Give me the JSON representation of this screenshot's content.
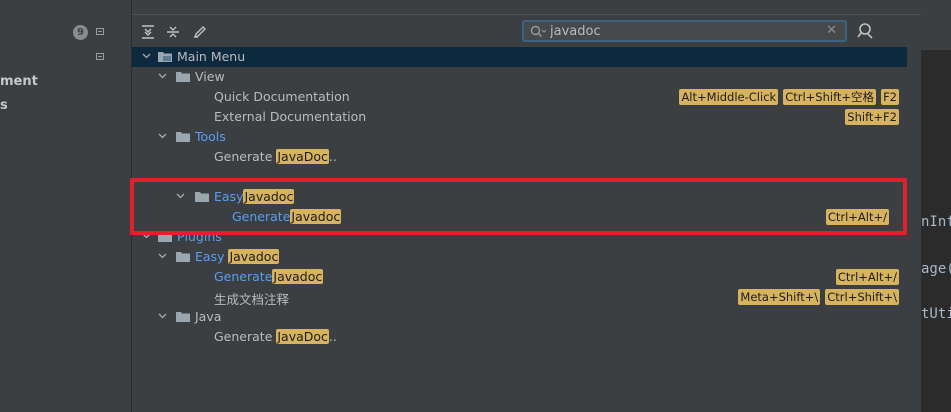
{
  "sidebar": {
    "badge_count": "9",
    "items": [
      "ment",
      "s"
    ]
  },
  "editor": {
    "fragments": [
      "nInf",
      "age(",
      "tUti"
    ]
  },
  "toolbar": {
    "buttons": [
      {
        "name": "expand-all-icon"
      },
      {
        "name": "collapse-all-icon"
      },
      {
        "name": "edit-shortcut-icon"
      }
    ],
    "search": {
      "value": "javadoc",
      "placeholder": ""
    }
  },
  "tree": {
    "main_menu": "Main Menu",
    "view": "View",
    "quick_doc": "Quick Documentation",
    "quick_doc_sc": [
      "Alt+Middle-Click",
      "Ctrl+Shift+空格",
      "F2"
    ],
    "external_doc": "External Documentation",
    "external_doc_sc": [
      "Shift+F2"
    ],
    "tools": "Tools",
    "generate_prefix": "Generate ",
    "javadoc_word": "JavaDoc",
    "ellipsis": "..",
    "easy": "Easy",
    "javadoc_cap": "Javadoc",
    "generate": "Generate",
    "easy_generate_sc": [
      "Ctrl+Alt+/"
    ],
    "plugins": "Plugins",
    "chinese_item": "生成文档注释",
    "chinese_item_sc": [
      "Meta+Shift+\\",
      "Ctrl+Shift+\\"
    ],
    "java": "Java"
  },
  "colors": {
    "background": "#3c3f41",
    "selection": "#0d293e",
    "match_highlight": "#d7b25f",
    "link_blue": "#589df6",
    "annotation_red": "#e0202a"
  }
}
